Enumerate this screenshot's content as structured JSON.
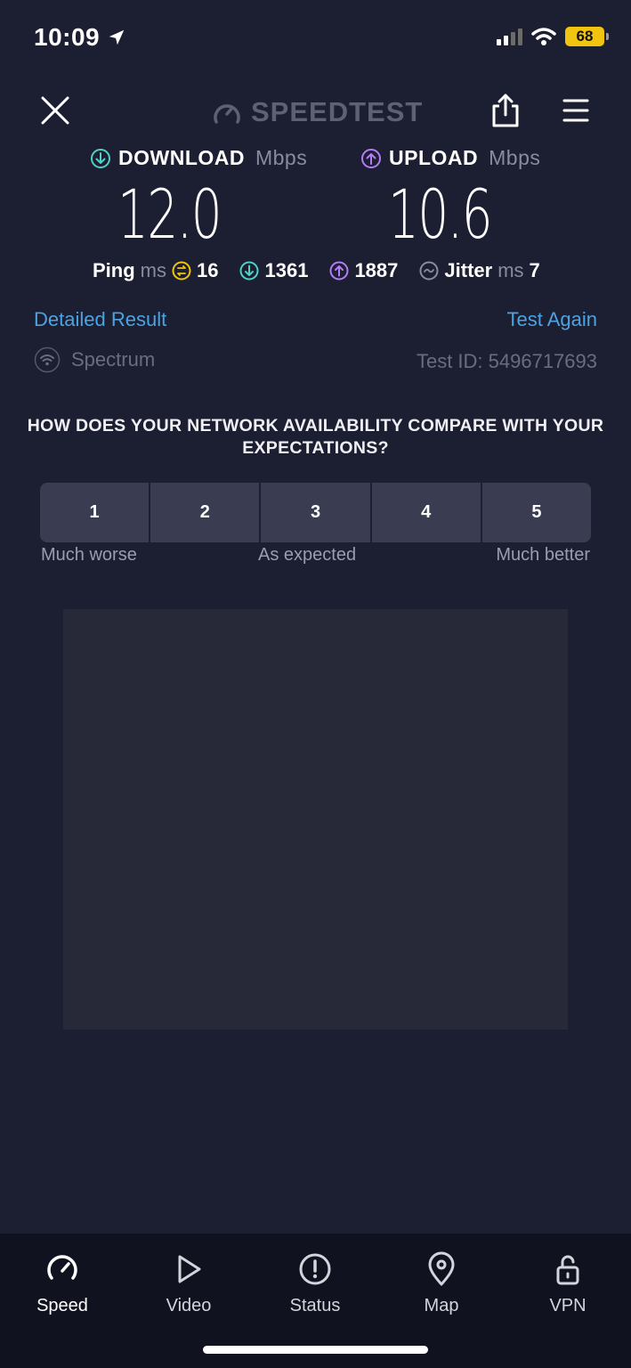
{
  "status_bar": {
    "time": "10:09",
    "battery": "68",
    "icons": [
      "location-arrow-icon",
      "cellular-signal-icon",
      "wifi-icon",
      "battery-icon"
    ]
  },
  "header": {
    "brand": "SPEEDTEST",
    "icons": [
      "close-icon",
      "speedometer-icon",
      "share-icon",
      "menu-icon"
    ]
  },
  "results": {
    "download": {
      "label": "DOWNLOAD",
      "unit": "Mbps",
      "value": "12.0",
      "color": "#4fd1c5"
    },
    "upload": {
      "label": "UPLOAD",
      "unit": "Mbps",
      "value": "10.6",
      "color": "#b57cf5"
    },
    "ping": {
      "label": "Ping",
      "unit": "ms",
      "idle": "16",
      "download": "1361",
      "upload": "1887",
      "jitter_label": "Jitter",
      "jitter_unit": "ms",
      "jitter": "7",
      "idle_color": "#f1c40f"
    }
  },
  "links": {
    "detailed": "Detailed Result",
    "again": "Test Again",
    "isp": "Spectrum",
    "test_id": "Test ID: 5496717693"
  },
  "survey": {
    "question": "HOW DOES YOUR NETWORK AVAILABILITY COMPARE WITH YOUR EXPECTATIONS?",
    "options": [
      "1",
      "2",
      "3",
      "4",
      "5"
    ],
    "labels": {
      "low": "Much worse",
      "mid": "As expected",
      "high": "Much better"
    }
  },
  "tabs": [
    {
      "label": "Speed",
      "icon": "speedometer-icon",
      "active": true
    },
    {
      "label": "Video",
      "icon": "play-icon",
      "active": false
    },
    {
      "label": "Status",
      "icon": "alert-icon",
      "active": false
    },
    {
      "label": "Map",
      "icon": "map-pin-icon",
      "active": false
    },
    {
      "label": "VPN",
      "icon": "lock-icon",
      "active": false
    }
  ],
  "colors": {
    "background": "#1c1e31",
    "link": "#4ba3e3",
    "tabbar": "#11121f"
  }
}
